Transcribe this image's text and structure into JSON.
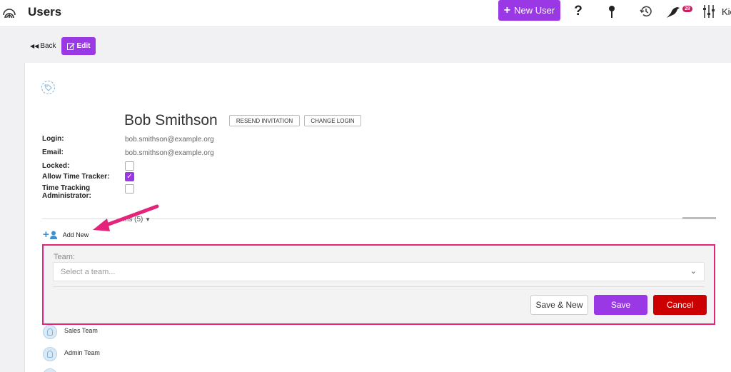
{
  "header": {
    "title": "Users",
    "new_user_label": "New User",
    "notification_count": "28",
    "cut_text": "Kie"
  },
  "toolbar": {
    "back_label": "Back",
    "edit_label": "Edit"
  },
  "profile": {
    "name": "Bob Smithson",
    "resend_label": "RESEND INVITATION",
    "change_login_label": "CHANGE LOGIN",
    "fields": {
      "login_label": "Login:",
      "login_value": "bob.smithson@example.org",
      "email_label": "Email:",
      "email_value": "bob.smithson@example.org",
      "locked_label": "Locked:",
      "locked": false,
      "time_tracker_label": "Allow Time Tracker:",
      "time_tracker": true,
      "tt_admin_label_1": "Time Tracking",
      "tt_admin_label_2": "Administrator:",
      "tt_admin": false
    }
  },
  "teams": {
    "tab_label": "ms (5)",
    "add_new_label": "Add New",
    "form": {
      "team_label": "Team:",
      "team_placeholder": "Select a team...",
      "save_new_label": "Save & New",
      "save_label": "Save",
      "cancel_label": "Cancel"
    },
    "items": [
      {
        "name": "Sales Team"
      },
      {
        "name": "Admin Team"
      }
    ]
  },
  "colors": {
    "accent": "#9a38e6",
    "cancel": "#cc0000",
    "highlight": "#e3247a"
  }
}
